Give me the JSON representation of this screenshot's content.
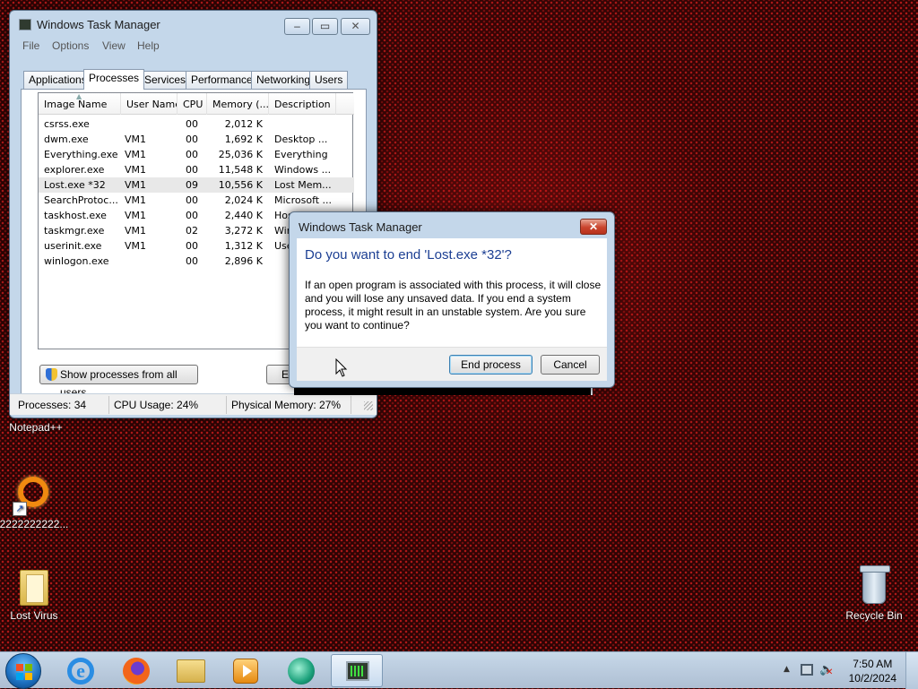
{
  "desktop": {
    "icons": [
      {
        "label": "Notepad++"
      },
      {
        "label": "2222222222..."
      },
      {
        "label": "Lost Virus"
      },
      {
        "label": "Recycle Bin"
      }
    ]
  },
  "task_manager": {
    "title": "Windows Task Manager",
    "menu": [
      "File",
      "Options",
      "View",
      "Help"
    ],
    "tabs": [
      "Applications",
      "Processes",
      "Services",
      "Performance",
      "Networking",
      "Users"
    ],
    "active_tab": "Processes",
    "columns": [
      "Image Name",
      "User Name",
      "CPU",
      "Memory (...",
      "Description"
    ],
    "rows": [
      {
        "image": "csrss.exe",
        "user": "",
        "cpu": "00",
        "mem": "2,012 K",
        "desc": ""
      },
      {
        "image": "dwm.exe",
        "user": "VM1",
        "cpu": "00",
        "mem": "1,692 K",
        "desc": "Desktop ..."
      },
      {
        "image": "Everything.exe",
        "user": "VM1",
        "cpu": "00",
        "mem": "25,036 K",
        "desc": "Everything"
      },
      {
        "image": "explorer.exe",
        "user": "VM1",
        "cpu": "00",
        "mem": "11,548 K",
        "desc": "Windows ..."
      },
      {
        "image": "Lost.exe *32",
        "user": "VM1",
        "cpu": "09",
        "mem": "10,556 K",
        "desc": "Lost Mem..."
      },
      {
        "image": "SearchProtoc...",
        "user": "VM1",
        "cpu": "00",
        "mem": "2,024 K",
        "desc": "Microsoft ..."
      },
      {
        "image": "taskhost.exe",
        "user": "VM1",
        "cpu": "00",
        "mem": "2,440 K",
        "desc": "Hos"
      },
      {
        "image": "taskmgr.exe",
        "user": "VM1",
        "cpu": "02",
        "mem": "3,272 K",
        "desc": "Wir"
      },
      {
        "image": "userinit.exe",
        "user": "VM1",
        "cpu": "00",
        "mem": "1,312 K",
        "desc": "Use"
      },
      {
        "image": "winlogon.exe",
        "user": "",
        "cpu": "00",
        "mem": "2,896 K",
        "desc": ""
      }
    ],
    "show_all_button": "Show processes from all users",
    "end_button_partial": "E",
    "status": {
      "processes": "Processes: 34",
      "cpu": "CPU Usage: 24%",
      "memory": "Physical Memory: 27%"
    }
  },
  "dialog": {
    "title": "Windows Task Manager",
    "main_instruction": "Do you want to end 'Lost.exe *32'?",
    "content": "If an open program is associated with this process, it will close and you will lose any unsaved data. If you end a system process, it might result in an unstable system. Are you sure you want to continue?",
    "end_button": "End process",
    "cancel_button": "Cancel"
  },
  "taskbar": {
    "apps": [
      "internet-explorer",
      "firefox",
      "windows-explorer",
      "media-player",
      "browser-globe",
      "task-manager"
    ],
    "clock_time": "7:50 AM",
    "clock_date": "10/2/2024"
  },
  "colors": {
    "desktop_bg": "#2a0404",
    "dialog_instruction": "#1c3f93",
    "close_button": "#c9442d"
  }
}
